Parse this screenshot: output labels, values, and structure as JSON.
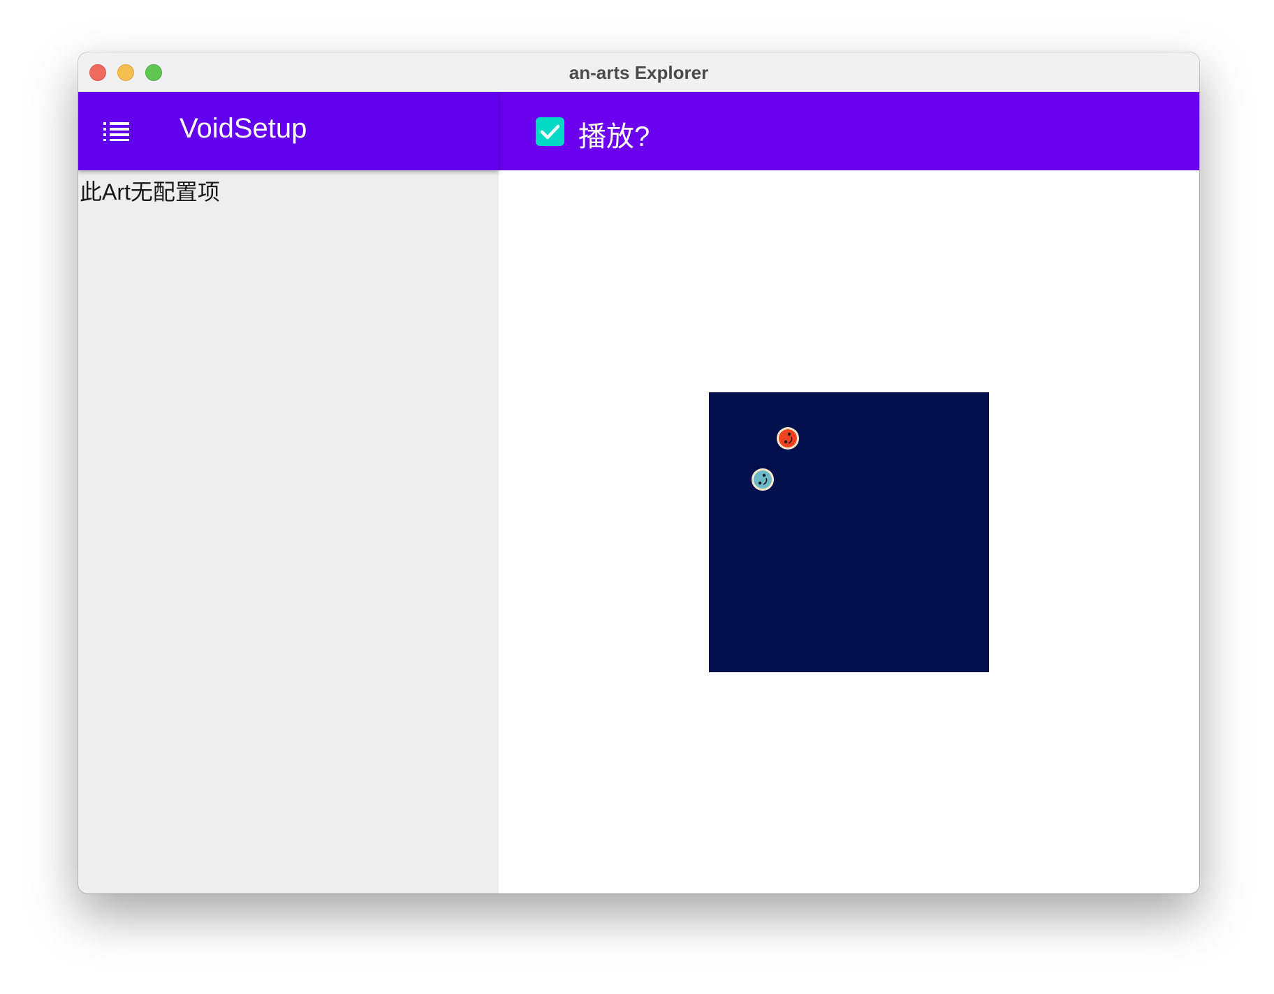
{
  "window": {
    "title": "an-arts Explorer"
  },
  "sidebar": {
    "title": "VoidSetup",
    "message": "此Art无配置项",
    "menu_icon": "list-menu-icon"
  },
  "toolbar": {
    "play_label": "播放?",
    "play_checked": true
  },
  "canvas": {
    "background_color": "#03104e",
    "balls": [
      {
        "name": "red-ball",
        "color": "#f0421f"
      },
      {
        "name": "teal-ball",
        "color": "#6cb8c6"
      }
    ]
  },
  "colors": {
    "primary": "#6200ee",
    "accent": "#03dac6",
    "sidebar_bg": "#eeeeee"
  }
}
